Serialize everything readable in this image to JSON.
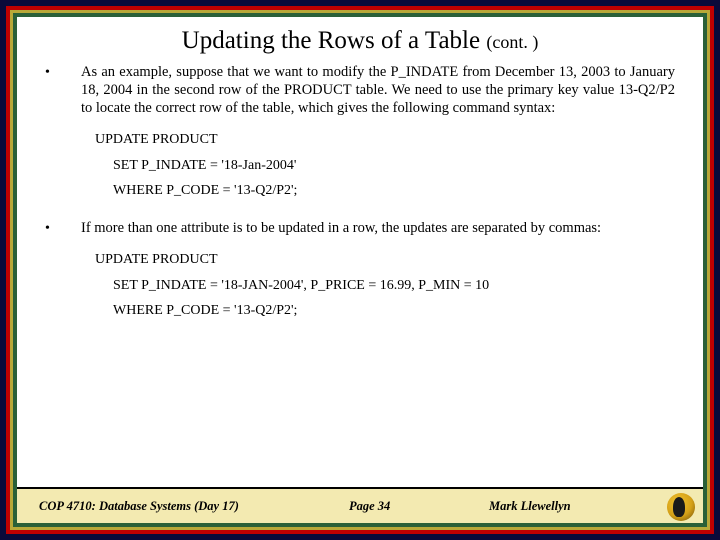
{
  "title": {
    "main": "Updating the Rows of a Table ",
    "cont": "(cont. )"
  },
  "bullets": [
    {
      "marker": "•",
      "text": "As an example, suppose that we want to modify the P_INDATE from December 13, 2003 to January 18, 2004 in the second row of the PRODUCT table.  We need to use the primary key value 13-Q2/P2 to locate the correct row of the table, which gives the following command syntax:"
    },
    {
      "marker": "•",
      "text": "If more than one attribute is to be updated in a row, the updates are separated by commas:"
    }
  ],
  "code1": {
    "line1": "UPDATE PRODUCT",
    "line2": "SET P_INDATE = '18-Jan-2004'",
    "line3": "WHERE P_CODE = '13-Q2/P2';"
  },
  "code2": {
    "line1": "UPDATE PRODUCT",
    "line2": "SET P_INDATE = '18-JAN-2004', P_PRICE = 16.99, P_MIN = 10",
    "line3": "WHERE P_CODE = '13-Q2/P2';"
  },
  "footer": {
    "left": "COP 4710: Database Systems (Day 17)",
    "center": "Page 34",
    "right": "Mark Llewellyn"
  }
}
